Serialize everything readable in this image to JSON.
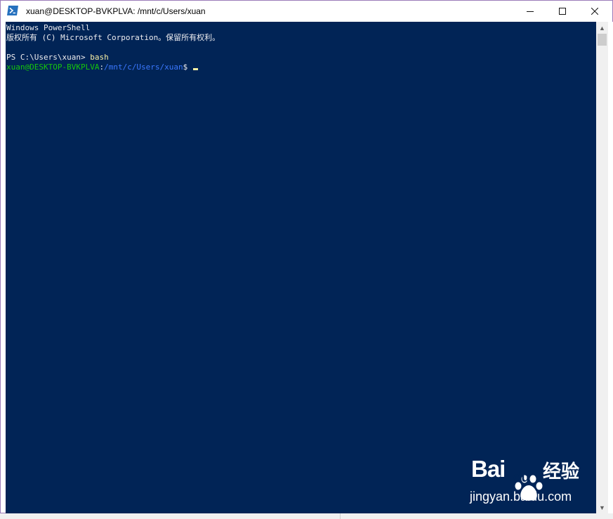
{
  "window": {
    "title": "xuan@DESKTOP-BVKPLVA: /mnt/c/Users/xuan",
    "icon": "powershell-icon",
    "controls": {
      "minimize": "—",
      "maximize": "☐",
      "close": "✕"
    }
  },
  "console": {
    "background": "#012456",
    "line1": "Windows PowerShell",
    "line2": "版权所有 (C) Microsoft Corporation。保留所有权利。",
    "ps_prompt": "PS C:\\Users\\xuan> ",
    "ps_command": "bash",
    "bash_user": "xuan@DESKTOP-BVKPLVA",
    "bash_sep": ":",
    "bash_path": "/mnt/c/Users/xuan",
    "bash_dollar": "$ "
  },
  "scrollbar": {
    "up_arrow": "▲",
    "down_arrow": "▼"
  },
  "watermark": {
    "brand": "Bai",
    "brand_du": "du",
    "brand_cn": "经验",
    "url": "jingyan.baidu.com"
  }
}
